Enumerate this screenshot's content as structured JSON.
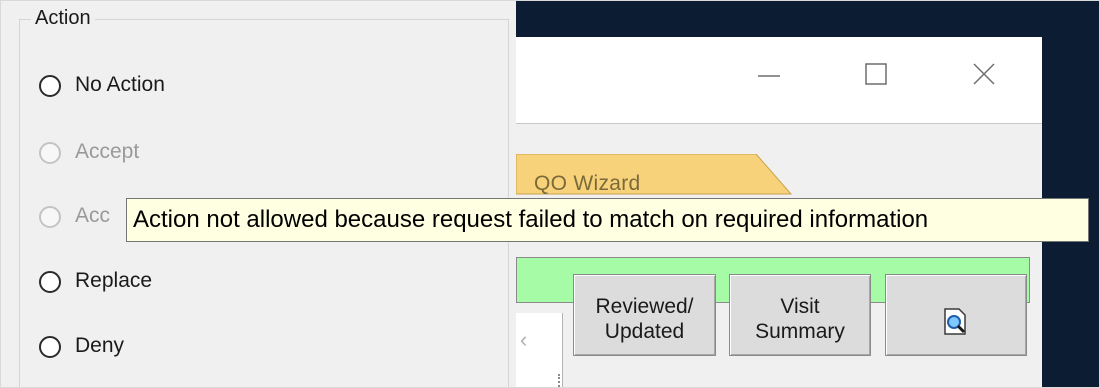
{
  "action_group": {
    "label": "Action",
    "options": [
      {
        "label": "No Action",
        "enabled": true
      },
      {
        "label": "Accept",
        "enabled": false
      },
      {
        "label": "Acc",
        "enabled": false
      },
      {
        "label": "Replace",
        "enabled": true
      },
      {
        "label": "Deny",
        "enabled": true
      }
    ]
  },
  "tooltip": {
    "text": "Action not allowed because request failed to match on required information"
  },
  "background_window": {
    "tab_label": "QO Wizard",
    "buttons": {
      "reviewed": "Reviewed/\nUpdated",
      "visit": "Visit\nSummary"
    },
    "icons": {
      "minimize": "minimize-icon",
      "maximize": "maximize-icon",
      "close": "close-icon",
      "preview": "document-preview-icon"
    }
  },
  "colors": {
    "desktop": "#0c1d33",
    "tooltip_bg": "#ffffe1",
    "status_bar": "#a6fba6",
    "tab": "#f7d27a"
  }
}
